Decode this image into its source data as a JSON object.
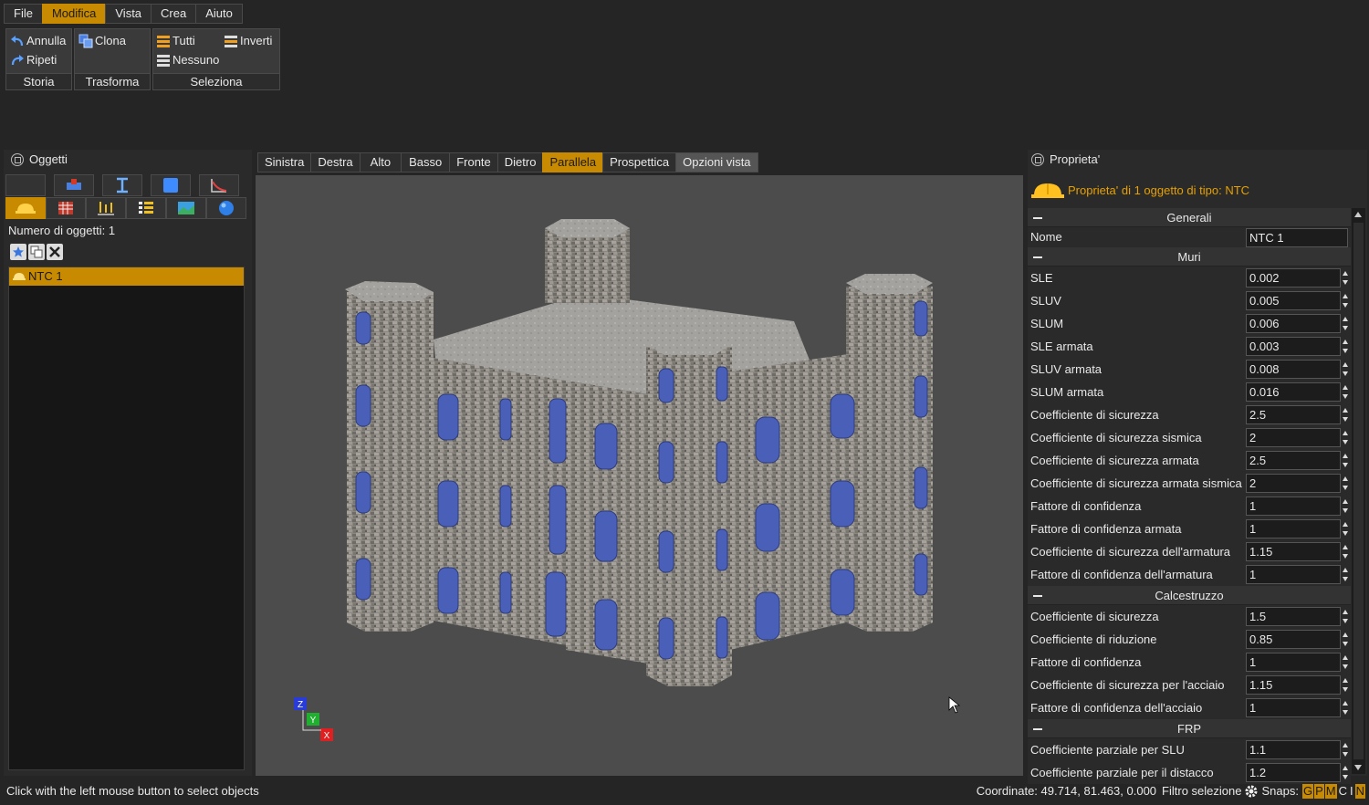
{
  "menu": [
    "File",
    "Modifica",
    "Vista",
    "Crea",
    "Aiuto"
  ],
  "menu_active": "Modifica",
  "ribbon": {
    "storia": {
      "undo": "Annulla",
      "redo": "Ripeti",
      "label": "Storia"
    },
    "trasforma": {
      "clone": "Clona",
      "label": "Trasforma"
    },
    "seleziona": {
      "all": "Tutti",
      "invert": "Inverti",
      "none": "Nessuno",
      "label": "Seleziona"
    }
  },
  "objects": {
    "title": "Oggetti",
    "count_label": "Numero di oggetti: 1",
    "items": [
      "NTC 1"
    ]
  },
  "view_tabs": [
    "Sinistra",
    "Destra",
    "Alto",
    "Basso",
    "Fronte",
    "Dietro",
    "Parallela",
    "Prospettica",
    "Opzioni vista"
  ],
  "view_active": "Parallela",
  "properties": {
    "title": "Proprieta'",
    "header": "Proprieta' di 1 oggetto di tipo: NTC",
    "sections": {
      "generali": {
        "title": "Generali",
        "rows": [
          {
            "label": "Nome",
            "value": "NTC 1"
          }
        ]
      },
      "muri": {
        "title": "Muri",
        "rows": [
          {
            "label": "SLE",
            "value": "0.002"
          },
          {
            "label": "SLUV",
            "value": "0.005"
          },
          {
            "label": "SLUM",
            "value": "0.006"
          },
          {
            "label": "SLE armata",
            "value": "0.003"
          },
          {
            "label": "SLUV armata",
            "value": "0.008"
          },
          {
            "label": "SLUM armata",
            "value": "0.016"
          },
          {
            "label": "Coefficiente di sicurezza",
            "value": "2.5"
          },
          {
            "label": "Coefficiente di sicurezza sismica",
            "value": "2"
          },
          {
            "label": "Coefficiente di sicurezza armata",
            "value": "2.5"
          },
          {
            "label": "Coefficiente di sicurezza armata sismica",
            "value": "2"
          },
          {
            "label": "Fattore di confidenza",
            "value": "1"
          },
          {
            "label": "Fattore di confidenza armata",
            "value": "1"
          },
          {
            "label": "Coefficiente di sicurezza dell'armatura",
            "value": "1.15"
          },
          {
            "label": "Fattore di confidenza dell'armatura",
            "value": "1"
          }
        ]
      },
      "calcestruzzo": {
        "title": "Calcestruzzo",
        "rows": [
          {
            "label": "Coefficiente di sicurezza",
            "value": "1.5"
          },
          {
            "label": "Coefficiente di riduzione",
            "value": "0.85"
          },
          {
            "label": "Fattore di confidenza",
            "value": "1"
          },
          {
            "label": "Coefficiente di sicurezza per l'acciaio",
            "value": "1.15"
          },
          {
            "label": "Fattore di confidenza dell'acciaio",
            "value": "1"
          }
        ]
      },
      "frp": {
        "title": "FRP",
        "rows": [
          {
            "label": "Coefficiente parziale per SLU",
            "value": "1.1"
          },
          {
            "label": "Coefficiente parziale per il distacco",
            "value": "1.2"
          }
        ]
      }
    }
  },
  "status": {
    "hint": "Click with the left mouse button to select objects",
    "coords": "Coordinate: 49.714, 81.463, 0.000",
    "filter": "Filtro selezione",
    "snaps_label": "Snaps:",
    "snaps": [
      {
        "k": "G",
        "on": true
      },
      {
        "k": "P",
        "on": true
      },
      {
        "k": "M",
        "on": true
      },
      {
        "k": "C",
        "on": false
      },
      {
        "k": "I",
        "on": false
      },
      {
        "k": "N",
        "on": true
      }
    ]
  },
  "colors": {
    "accent": "#c88a00",
    "window": "#4a5fb8",
    "stone": "#8d8a84"
  }
}
